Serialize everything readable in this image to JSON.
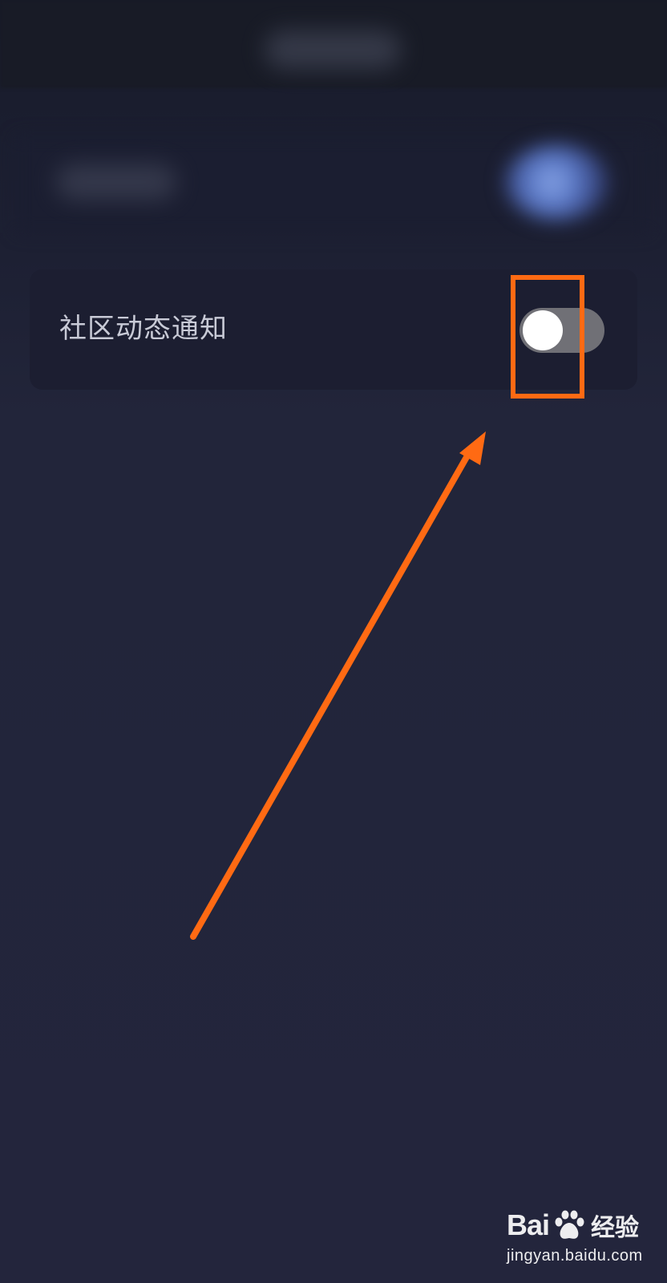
{
  "settings": {
    "community_notification_label": "社区动态通知",
    "community_notification_enabled": false
  },
  "colors": {
    "background": "#23253c",
    "card": "#1c1e31",
    "toggle_off_track": "#707076",
    "toggle_knob": "#ffffff",
    "highlight": "#ff6a13"
  },
  "watermark": {
    "logo_left": "Bai",
    "logo_right": "经验",
    "url": "jingyan.baidu.com",
    "icon": "baidu-paw-icon"
  }
}
